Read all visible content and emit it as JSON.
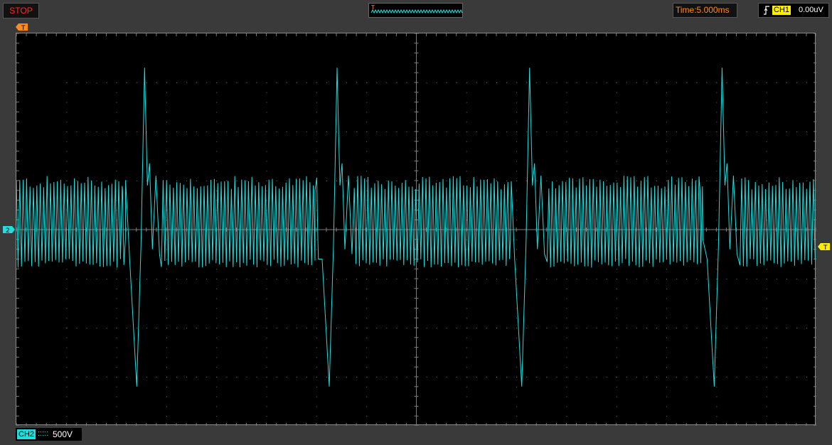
{
  "toolbar": {
    "run_state": "STOP",
    "timebase": "Time:5.000ms",
    "trigger": {
      "channel": "CH1",
      "level": "0.00uV",
      "edge_icon": "rising-edge-icon"
    },
    "overview_marker": "T"
  },
  "channel_readout": {
    "channel": "CH2",
    "coupling": ":::::",
    "volts_per_div": "500V"
  },
  "markers": {
    "trigger_position": "T",
    "ch2_ground": "2",
    "trigger_level": "T"
  },
  "colors": {
    "stop": "#ff2a1a",
    "timebase": "#ff8a1e",
    "ch1": "#ffee00",
    "ch2": "#22dddd",
    "trigger_marker": "#ff8a1e"
  },
  "chart_data": {
    "type": "line",
    "title": "",
    "xlabel": "",
    "ylabel": "",
    "grid": true,
    "x_divisions": 16,
    "y_divisions": 8,
    "series": [
      {
        "channel": "CH2",
        "description": "repetitive pulse train with periodic spikes",
        "baseline_div": 0,
        "ripple_amplitude_div": [
          -0.8,
          1.0
        ],
        "spike_times_div": [
          2.55,
          6.4,
          10.25,
          14.1
        ],
        "spike_peak_div": 3.3,
        "spike_trough_div": -3.2
      }
    ]
  }
}
